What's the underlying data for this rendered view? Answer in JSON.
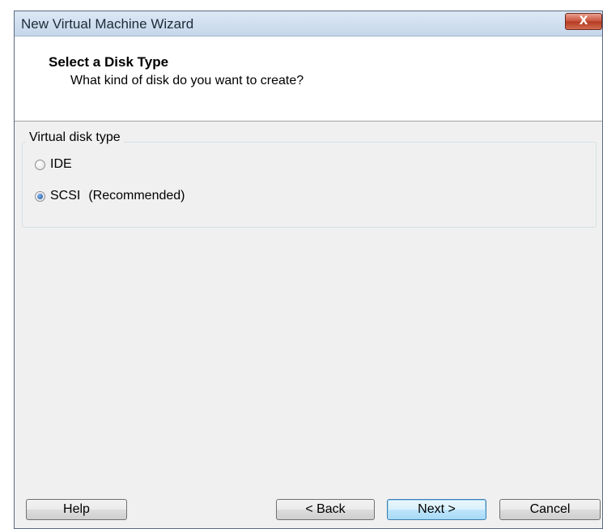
{
  "window": {
    "title": "New Virtual Machine Wizard",
    "close_glyph": "X"
  },
  "header": {
    "title": "Select a Disk Type",
    "subtitle": "What kind of disk do you want to create?"
  },
  "disk_type": {
    "group_label": "Virtual disk type",
    "options": [
      {
        "label": "IDE",
        "note": "",
        "selected": false
      },
      {
        "label": "SCSI",
        "note": "(Recommended)",
        "selected": true
      }
    ]
  },
  "buttons": {
    "help": "Help",
    "back": "< Back",
    "next": "Next >",
    "cancel": "Cancel"
  },
  "colors": {
    "titlebar": "#c6d7ea",
    "close_button": "#c9503a",
    "default_button_border": "#3c7fb1"
  },
  "icons": {
    "close": "close-icon",
    "radio_unchecked": "radio-unchecked-icon",
    "radio_checked": "radio-checked-icon"
  }
}
